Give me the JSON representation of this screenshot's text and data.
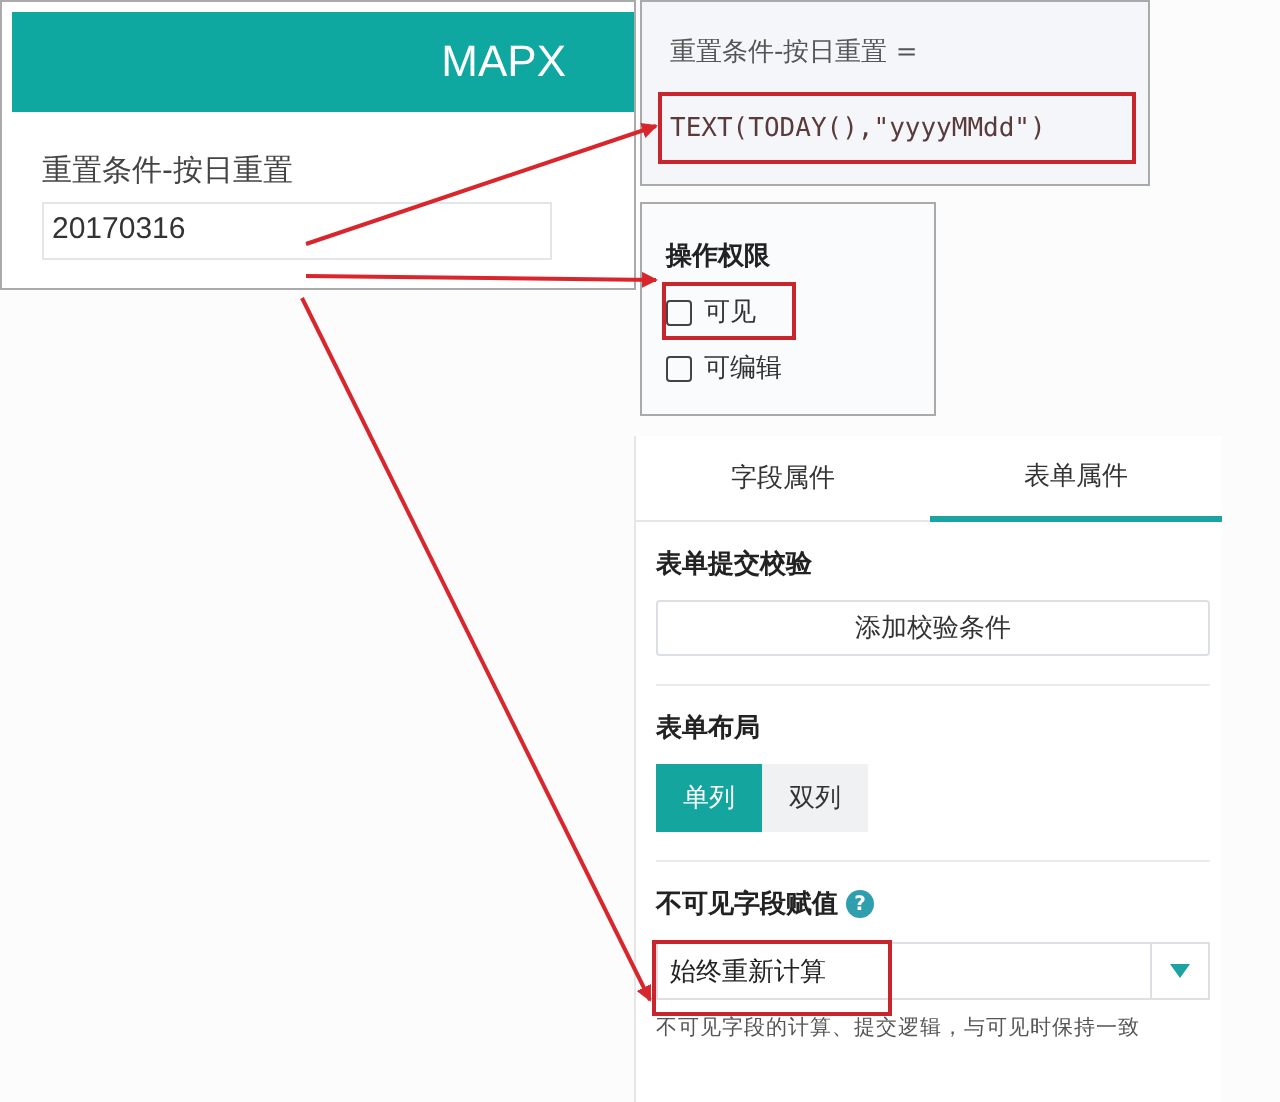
{
  "form_preview": {
    "title": "MAPX",
    "field_label": "重置条件-按日重置",
    "field_value": "20170316"
  },
  "formula_panel": {
    "title": "重置条件-按日重置 =",
    "formula": "TEXT(TODAY(),\"yyyyMMdd\")"
  },
  "permissions_panel": {
    "title": "操作权限",
    "options": [
      {
        "label": "可见",
        "checked": false
      },
      {
        "label": "可编辑",
        "checked": false
      }
    ]
  },
  "properties_panel": {
    "tabs": [
      {
        "label": "字段属件",
        "selected": false
      },
      {
        "label": "表单属件",
        "selected": true
      }
    ],
    "validation": {
      "title": "表单提交校验",
      "button": "添加校验条件"
    },
    "layout": {
      "title": "表单布局",
      "options": [
        {
          "label": "单列",
          "selected": true
        },
        {
          "label": "双列",
          "selected": false
        }
      ]
    },
    "invisible_value": {
      "title": "不可见字段赋值",
      "help_icon": "?",
      "value": "始终重新计算",
      "hint": "不可见字段的计算、提交逻辑，与可见时保持一致"
    }
  }
}
